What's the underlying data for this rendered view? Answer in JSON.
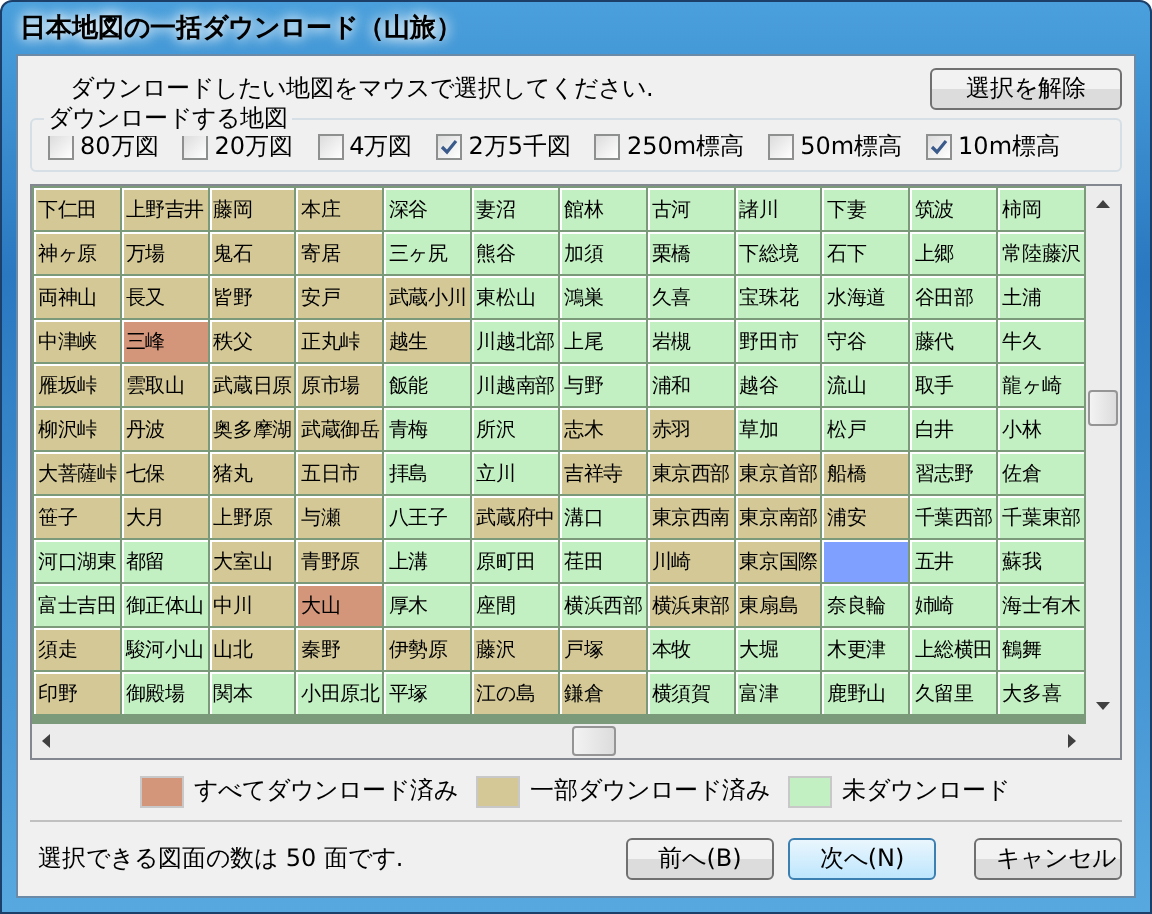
{
  "window": {
    "title": "日本地図の一括ダウンロード（山旅）"
  },
  "instruction": "ダウンロードしたい地図をマウスで選択してください.",
  "clear_button": "選択を解除",
  "map_types": {
    "label": "ダウンロードする地図",
    "options": [
      {
        "label": "80万図",
        "checked": false
      },
      {
        "label": "20万図",
        "checked": false
      },
      {
        "label": "4万図",
        "checked": false
      },
      {
        "label": "2万5千図",
        "checked": true
      },
      {
        "label": "250m標高",
        "checked": false
      },
      {
        "label": "50m標高",
        "checked": false
      },
      {
        "label": "10m標高",
        "checked": true
      }
    ]
  },
  "grid": {
    "rows": [
      {
        "cells": [
          {
            "name": "下仁田",
            "color": "#d3c896"
          },
          {
            "name": "上野吉井",
            "color": "#d3c896"
          },
          {
            "name": "藤岡",
            "color": "#d3c896"
          },
          {
            "name": "本庄",
            "color": "#d3c896"
          },
          {
            "name": "深谷",
            "color": "#c3f0c3"
          },
          {
            "name": "妻沼",
            "color": "#c3f0c3"
          },
          {
            "name": "館林",
            "color": "#c3f0c3"
          },
          {
            "name": "古河",
            "color": "#c3f0c3"
          },
          {
            "name": "諸川",
            "color": "#c3f0c3"
          },
          {
            "name": "下妻",
            "color": "#c3f0c3"
          },
          {
            "name": "筑波",
            "color": "#c3f0c3"
          },
          {
            "name": "柿岡",
            "color": "#c3f0c3"
          }
        ]
      },
      {
        "cells": [
          {
            "name": "神ヶ原",
            "color": "#d3c896"
          },
          {
            "name": "万場",
            "color": "#d3c896"
          },
          {
            "name": "鬼石",
            "color": "#d3c896"
          },
          {
            "name": "寄居",
            "color": "#d3c896"
          },
          {
            "name": "三ヶ尻",
            "color": "#c3f0c3"
          },
          {
            "name": "熊谷",
            "color": "#c3f0c3"
          },
          {
            "name": "加須",
            "color": "#c3f0c3"
          },
          {
            "name": "栗橋",
            "color": "#c3f0c3"
          },
          {
            "name": "下総境",
            "color": "#c3f0c3"
          },
          {
            "name": "石下",
            "color": "#c3f0c3"
          },
          {
            "name": "上郷",
            "color": "#c3f0c3"
          },
          {
            "name": "常陸藤沢",
            "color": "#c3f0c3"
          }
        ]
      },
      {
        "cells": [
          {
            "name": "両神山",
            "color": "#d3c896"
          },
          {
            "name": "長又",
            "color": "#d3c896"
          },
          {
            "name": "皆野",
            "color": "#d3c896"
          },
          {
            "name": "安戸",
            "color": "#d3c896"
          },
          {
            "name": "武蔵小川",
            "color": "#d3c896"
          },
          {
            "name": "東松山",
            "color": "#c3f0c3"
          },
          {
            "name": "鴻巣",
            "color": "#c3f0c3"
          },
          {
            "name": "久喜",
            "color": "#c3f0c3"
          },
          {
            "name": "宝珠花",
            "color": "#c3f0c3"
          },
          {
            "name": "水海道",
            "color": "#c3f0c3"
          },
          {
            "name": "谷田部",
            "color": "#c3f0c3"
          },
          {
            "name": "土浦",
            "color": "#c3f0c3"
          }
        ]
      },
      {
        "cells": [
          {
            "name": "中津峡",
            "color": "#d3c896"
          },
          {
            "name": "三峰",
            "color": "#d4967a"
          },
          {
            "name": "秩父",
            "color": "#d3c896"
          },
          {
            "name": "正丸峠",
            "color": "#d3c896"
          },
          {
            "name": "越生",
            "color": "#d3c896"
          },
          {
            "name": "川越北部",
            "color": "#c3f0c3"
          },
          {
            "name": "上尾",
            "color": "#c3f0c3"
          },
          {
            "name": "岩槻",
            "color": "#c3f0c3"
          },
          {
            "name": "野田市",
            "color": "#c3f0c3"
          },
          {
            "name": "守谷",
            "color": "#c3f0c3"
          },
          {
            "name": "藤代",
            "color": "#c3f0c3"
          },
          {
            "name": "牛久",
            "color": "#c3f0c3"
          }
        ]
      },
      {
        "cells": [
          {
            "name": "雁坂峠",
            "color": "#d3c896"
          },
          {
            "name": "雲取山",
            "color": "#d3c896"
          },
          {
            "name": "武蔵日原",
            "color": "#d3c896"
          },
          {
            "name": "原市場",
            "color": "#d3c896"
          },
          {
            "name": "飯能",
            "color": "#c3f0c3"
          },
          {
            "name": "川越南部",
            "color": "#c3f0c3"
          },
          {
            "name": "与野",
            "color": "#c3f0c3"
          },
          {
            "name": "浦和",
            "color": "#c3f0c3"
          },
          {
            "name": "越谷",
            "color": "#c3f0c3"
          },
          {
            "name": "流山",
            "color": "#c3f0c3"
          },
          {
            "name": "取手",
            "color": "#c3f0c3"
          },
          {
            "name": "龍ヶ崎",
            "color": "#c3f0c3"
          }
        ]
      },
      {
        "cells": [
          {
            "name": "柳沢峠",
            "color": "#d3c896"
          },
          {
            "name": "丹波",
            "color": "#d3c896"
          },
          {
            "name": "奥多摩湖",
            "color": "#d3c896"
          },
          {
            "name": "武蔵御岳",
            "color": "#d3c896"
          },
          {
            "name": "青梅",
            "color": "#c3f0c3"
          },
          {
            "name": "所沢",
            "color": "#c3f0c3"
          },
          {
            "name": "志木",
            "color": "#d3c896"
          },
          {
            "name": "赤羽",
            "color": "#d3c896"
          },
          {
            "name": "草加",
            "color": "#c3f0c3"
          },
          {
            "name": "松戸",
            "color": "#c3f0c3"
          },
          {
            "name": "白井",
            "color": "#c3f0c3"
          },
          {
            "name": "小林",
            "color": "#c3f0c3"
          }
        ]
      },
      {
        "cells": [
          {
            "name": "大菩薩峠",
            "color": "#d3c896"
          },
          {
            "name": "七保",
            "color": "#d3c896"
          },
          {
            "name": "猪丸",
            "color": "#d3c896"
          },
          {
            "name": "五日市",
            "color": "#d3c896"
          },
          {
            "name": "拝島",
            "color": "#c3f0c3"
          },
          {
            "name": "立川",
            "color": "#c3f0c3"
          },
          {
            "name": "吉祥寺",
            "color": "#d3c896"
          },
          {
            "name": "東京西部",
            "color": "#d3c896"
          },
          {
            "name": "東京首部",
            "color": "#d3c896"
          },
          {
            "name": "船橋",
            "color": "#d3c896"
          },
          {
            "name": "習志野",
            "color": "#c3f0c3"
          },
          {
            "name": "佐倉",
            "color": "#c3f0c3"
          }
        ]
      },
      {
        "cells": [
          {
            "name": "笹子",
            "color": "#d3c896"
          },
          {
            "name": "大月",
            "color": "#d3c896"
          },
          {
            "name": "上野原",
            "color": "#d3c896"
          },
          {
            "name": "与瀬",
            "color": "#d3c896"
          },
          {
            "name": "八王子",
            "color": "#c3f0c3"
          },
          {
            "name": "武蔵府中",
            "color": "#d3c896"
          },
          {
            "name": "溝口",
            "color": "#c3f0c3"
          },
          {
            "name": "東京西南",
            "color": "#d3c896"
          },
          {
            "name": "東京南部",
            "color": "#d3c896"
          },
          {
            "name": "浦安",
            "color": "#d3c896"
          },
          {
            "name": "千葉西部",
            "color": "#c3f0c3"
          },
          {
            "name": "千葉東部",
            "color": "#c3f0c3"
          }
        ]
      },
      {
        "cells": [
          {
            "name": "河口湖東",
            "color": "#c3f0c3"
          },
          {
            "name": "都留",
            "color": "#c3f0c3"
          },
          {
            "name": "大室山",
            "color": "#d3c896"
          },
          {
            "name": "青野原",
            "color": "#d3c896"
          },
          {
            "name": "上溝",
            "color": "#c3f0c3"
          },
          {
            "name": "原町田",
            "color": "#c3f0c3"
          },
          {
            "name": "荏田",
            "color": "#c3f0c3"
          },
          {
            "name": "川崎",
            "color": "#d3c896"
          },
          {
            "name": "東京国際",
            "color": "#d3c896"
          },
          {
            "color": "#80a0ff"
          },
          {
            "name": "五井",
            "color": "#c3f0c3"
          },
          {
            "name": "蘇我",
            "color": "#c3f0c3"
          }
        ]
      },
      {
        "cells": [
          {
            "name": "富士吉田",
            "color": "#c3f0c3"
          },
          {
            "name": "御正体山",
            "color": "#c3f0c3"
          },
          {
            "name": "中川",
            "color": "#d3c896"
          },
          {
            "name": "大山",
            "color": "#d4967a"
          },
          {
            "name": "厚木",
            "color": "#c3f0c3"
          },
          {
            "name": "座間",
            "color": "#c3f0c3"
          },
          {
            "name": "横浜西部",
            "color": "#c3f0c3"
          },
          {
            "name": "横浜東部",
            "color": "#d3c896"
          },
          {
            "name": "東扇島",
            "color": "#d3c896"
          },
          {
            "name": "奈良輪",
            "color": "#c3f0c3"
          },
          {
            "name": "姉崎",
            "color": "#c3f0c3"
          },
          {
            "name": "海士有木",
            "color": "#c3f0c3"
          }
        ]
      },
      {
        "cells": [
          {
            "name": "須走",
            "color": "#d3c896"
          },
          {
            "name": "駿河小山",
            "color": "#c3f0c3"
          },
          {
            "name": "山北",
            "color": "#d3c896"
          },
          {
            "name": "秦野",
            "color": "#d3c896"
          },
          {
            "name": "伊勢原",
            "color": "#d3c896"
          },
          {
            "name": "藤沢",
            "color": "#d3c896"
          },
          {
            "name": "戸塚",
            "color": "#d3c896"
          },
          {
            "name": "本牧",
            "color": "#c3f0c3"
          },
          {
            "name": "大堀",
            "color": "#c3f0c3"
          },
          {
            "name": "木更津",
            "color": "#c3f0c3"
          },
          {
            "name": "上総横田",
            "color": "#c3f0c3"
          },
          {
            "name": "鶴舞",
            "color": "#c3f0c3"
          }
        ]
      },
      {
        "cells": [
          {
            "name": "印野",
            "color": "#d3c896"
          },
          {
            "name": "御殿場",
            "color": "#c3f0c3"
          },
          {
            "name": "関本",
            "color": "#c3f0c3"
          },
          {
            "name": "小田原北",
            "color": "#c3f0c3"
          },
          {
            "name": "平塚",
            "color": "#c3f0c3"
          },
          {
            "name": "江の島",
            "color": "#d3c896"
          },
          {
            "name": "鎌倉",
            "color": "#d3c896"
          },
          {
            "name": "横須賀",
            "color": "#c3f0c3"
          },
          {
            "name": "富津",
            "color": "#c3f0c3"
          },
          {
            "name": "鹿野山",
            "color": "#c3f0c3"
          },
          {
            "name": "久留里",
            "color": "#c3f0c3"
          },
          {
            "name": "大多喜",
            "color": "#c3f0c3"
          }
        ]
      }
    ]
  },
  "legend": [
    {
      "color": "#d4967a",
      "label": "すべてダウンロード済み"
    },
    {
      "color": "#d3c896",
      "label": "一部ダウンロード済み"
    },
    {
      "color": "#c3f0c3",
      "label": "未ダウンロード"
    }
  ],
  "status_text": "選択できる図面の数は 50 面です.",
  "buttons": [
    {
      "label": "前へ(B)",
      "default": false
    },
    {
      "label": "次へ(N)",
      "default": true
    },
    {
      "label": "キャンセル",
      "default": false
    }
  ]
}
